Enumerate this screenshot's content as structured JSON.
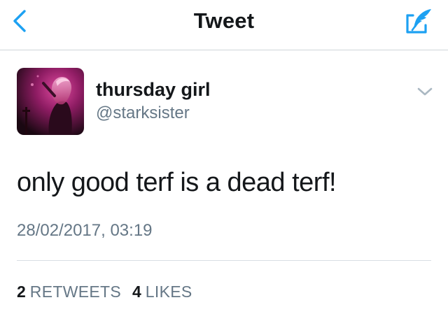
{
  "nav": {
    "title": "Tweet",
    "back_icon": "chevron-left-icon",
    "compose_icon": "compose-tweet-icon"
  },
  "colors": {
    "accent": "#1da1f2",
    "text_primary": "#14171a",
    "text_secondary": "#657786",
    "divider": "#d8dee3",
    "avatar_tint": "#c42d86"
  },
  "tweet": {
    "author": {
      "name": "thursday girl",
      "handle": "@starksister",
      "avatar_icon": "user-avatar-photo"
    },
    "text": "only good terf is a dead terf!",
    "timestamp": "28/02/2017, 03:19",
    "caret_icon": "chevron-down-icon"
  },
  "stats": {
    "retweets": {
      "count": "2",
      "label": "RETWEETS"
    },
    "likes": {
      "count": "4",
      "label": "LIKES"
    }
  }
}
